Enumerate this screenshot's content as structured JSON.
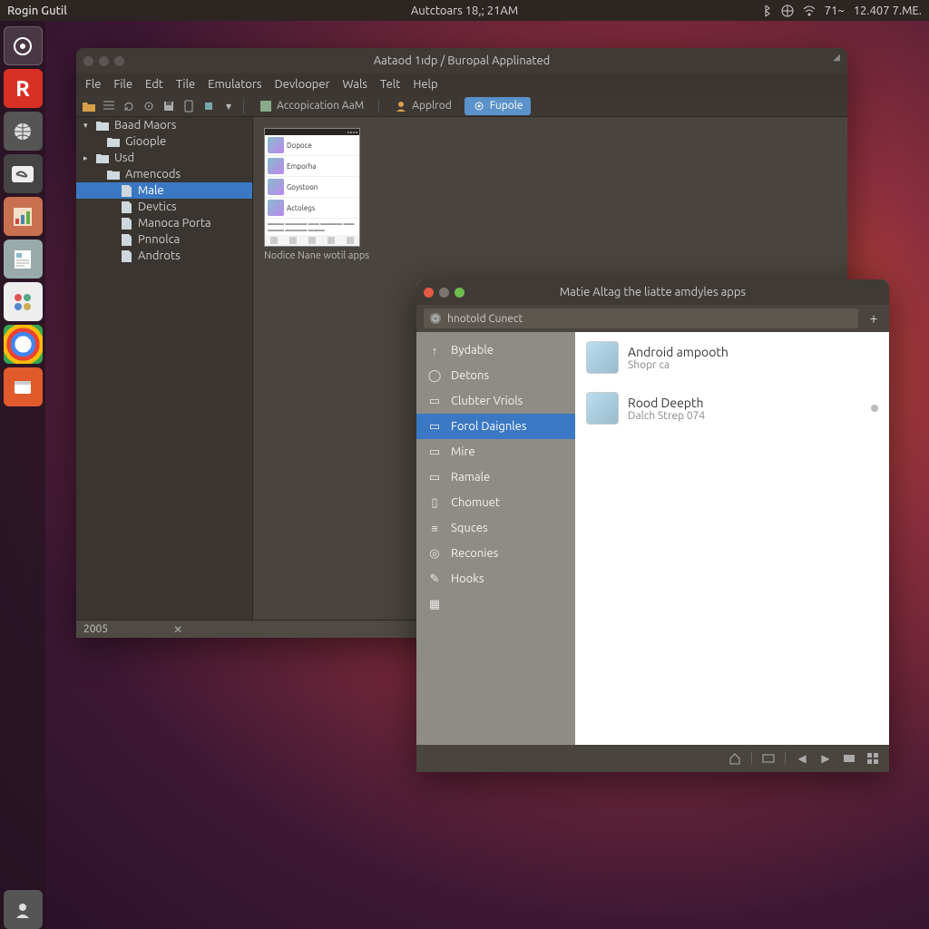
{
  "panel": {
    "left": "Rogin Gutil",
    "center": "Autctoars 18,; 21AM",
    "right_text1": "71~",
    "right_text2": "12.407 7.ME."
  },
  "launcher": [
    {
      "name": "dash",
      "icon": "◉"
    },
    {
      "name": "r-app",
      "icon": "R"
    },
    {
      "name": "globe",
      "icon": "🌐"
    },
    {
      "name": "files",
      "icon": "🔗"
    },
    {
      "name": "office",
      "icon": "📊"
    },
    {
      "name": "doc",
      "icon": "📄"
    },
    {
      "name": "admin",
      "icon": "⚙"
    },
    {
      "name": "chrome",
      "icon": ""
    },
    {
      "name": "term",
      "icon": "💻"
    }
  ],
  "w1": {
    "title": "Aataod 1ıdp / Buropal Applinated",
    "menus": [
      "Fle",
      "File",
      "Edt",
      "Tile",
      "Emulators",
      "Devlooper",
      "Wals",
      "Telt",
      "Help"
    ],
    "tb_btn1": "Accopication  AaM",
    "tb_btn2": "Applrod",
    "tb_btn3": "Fupole",
    "tree": [
      {
        "depth": 0,
        "tri": "▾",
        "ico": "folder",
        "label": "Baad Maors"
      },
      {
        "depth": 1,
        "tri": "",
        "ico": "folder",
        "label": "Gioople"
      },
      {
        "depth": 0,
        "tri": "▸",
        "ico": "folder",
        "label": "Usd"
      },
      {
        "depth": 1,
        "tri": "",
        "ico": "folder",
        "label": "Amencods"
      },
      {
        "depth": 2,
        "tri": "",
        "ico": "file",
        "label": "Male",
        "sel": true
      },
      {
        "depth": 2,
        "tri": "",
        "ico": "file",
        "label": "Devtics"
      },
      {
        "depth": 2,
        "tri": "",
        "ico": "file",
        "label": "Manoca Porta"
      },
      {
        "depth": 2,
        "tri": "",
        "ico": "file",
        "label": "Pnnolca"
      },
      {
        "depth": 2,
        "tri": "",
        "ico": "file",
        "label": "Androts"
      }
    ],
    "thumb_items": [
      "Dopoce",
      "Emporha",
      "Goystoon",
      "Actolegs"
    ],
    "thumb_label": "Nodice Nane wotil apps",
    "status": "2005"
  },
  "w2": {
    "title": "Matie Altag the liatte amdyles apps",
    "search_placeholder": "hnotold Cunect",
    "cats": [
      {
        "ico": "↑",
        "label": "Bydable"
      },
      {
        "ico": "◯",
        "label": "Detons"
      },
      {
        "ico": "▭",
        "label": "Clubter Vriols"
      },
      {
        "ico": "▭",
        "label": "Forol Daignles",
        "sel": true
      },
      {
        "ico": "▭",
        "label": "Mire"
      },
      {
        "ico": "▭",
        "label": "Ramale"
      },
      {
        "ico": "▯",
        "label": "Chomuet"
      },
      {
        "ico": "≡",
        "label": "Squces"
      },
      {
        "ico": "◎",
        "label": "Reconies"
      },
      {
        "ico": "✎",
        "label": "Hooks"
      },
      {
        "ico": "▦",
        "label": ""
      }
    ],
    "items": [
      {
        "title": "Android ampooth",
        "sub": "Shopr ca"
      },
      {
        "title": "Rood Deepth",
        "sub": "Dalch Strep 074",
        "dot": true
      }
    ]
  }
}
